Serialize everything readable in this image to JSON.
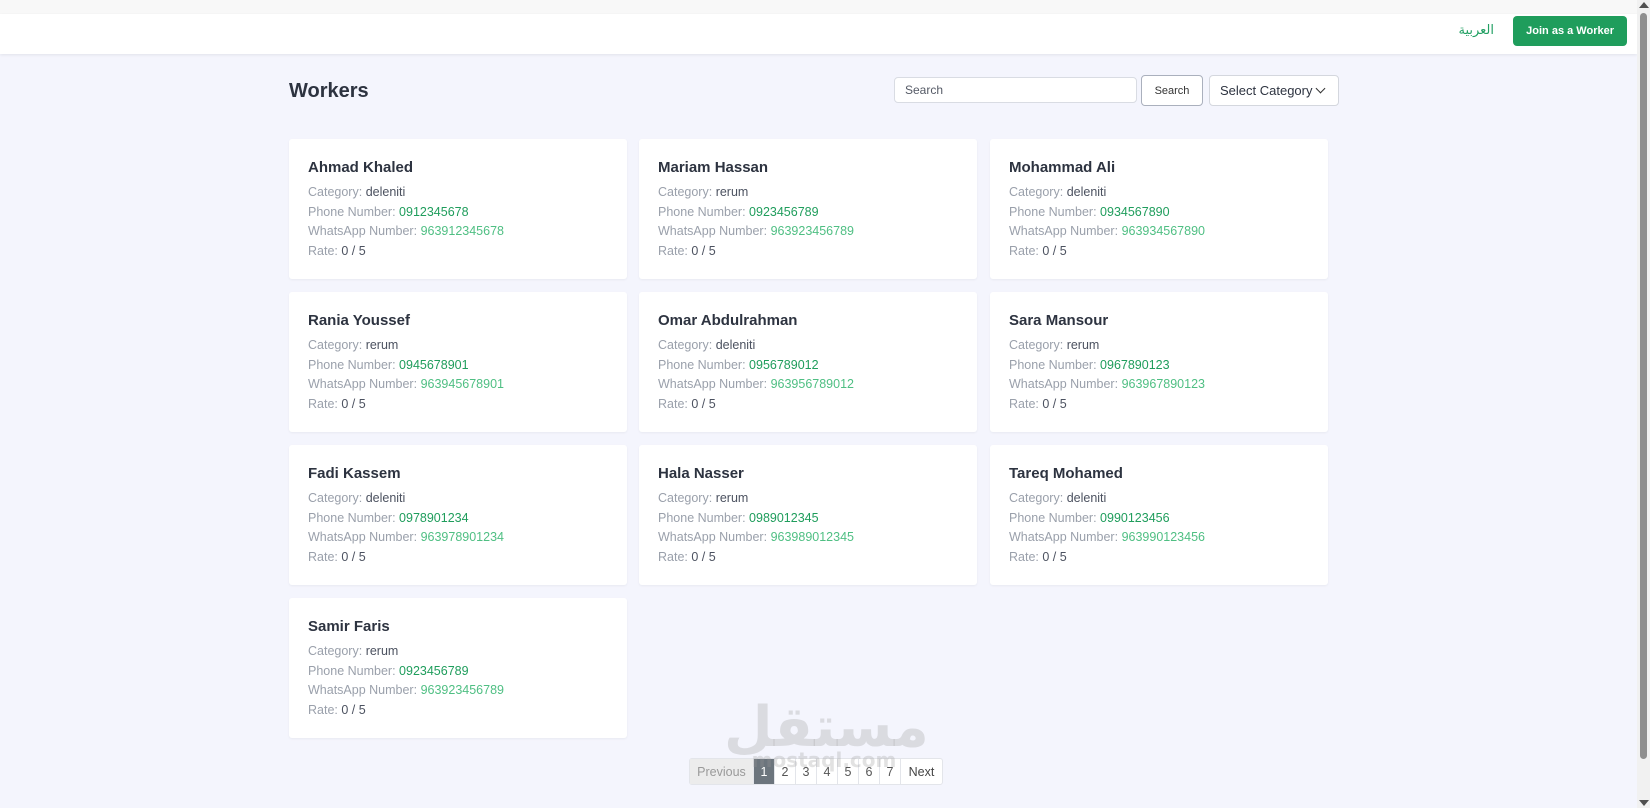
{
  "header": {
    "language_link": "العربية",
    "join_button": "Join as a Worker"
  },
  "page": {
    "title": "Workers"
  },
  "search": {
    "placeholder": "Search",
    "button_label": "Search",
    "category_select": "Select Category"
  },
  "labels": {
    "category": "Category:",
    "phone": "Phone Number:",
    "whatsapp": "WhatsApp Number:",
    "rate": "Rate:"
  },
  "workers": [
    {
      "name": "Ahmad Khaled",
      "category": "deleniti",
      "phone": "0912345678",
      "whatsapp": "963912345678",
      "rate": "0 / 5"
    },
    {
      "name": "Mariam Hassan",
      "category": "rerum",
      "phone": "0923456789",
      "whatsapp": "963923456789",
      "rate": "0 / 5"
    },
    {
      "name": "Mohammad Ali",
      "category": "deleniti",
      "phone": "0934567890",
      "whatsapp": "963934567890",
      "rate": "0 / 5"
    },
    {
      "name": "Rania Youssef",
      "category": "rerum",
      "phone": "0945678901",
      "whatsapp": "963945678901",
      "rate": "0 / 5"
    },
    {
      "name": "Omar Abdulrahman",
      "category": "deleniti",
      "phone": "0956789012",
      "whatsapp": "963956789012",
      "rate": "0 / 5"
    },
    {
      "name": "Sara Mansour",
      "category": "rerum",
      "phone": "0967890123",
      "whatsapp": "963967890123",
      "rate": "0 / 5"
    },
    {
      "name": "Fadi Kassem",
      "category": "deleniti",
      "phone": "0978901234",
      "whatsapp": "963978901234",
      "rate": "0 / 5"
    },
    {
      "name": "Hala Nasser",
      "category": "rerum",
      "phone": "0989012345",
      "whatsapp": "963989012345",
      "rate": "0 / 5"
    },
    {
      "name": "Tareq Mohamed",
      "category": "deleniti",
      "phone": "0990123456",
      "whatsapp": "963990123456",
      "rate": "0 / 5"
    },
    {
      "name": "Samir Faris",
      "category": "rerum",
      "phone": "0923456789",
      "whatsapp": "963923456789",
      "rate": "0 / 5"
    }
  ],
  "pagination": {
    "previous": "Previous",
    "next": "Next",
    "pages": [
      "1",
      "2",
      "3",
      "4",
      "5",
      "6",
      "7"
    ],
    "active": "1"
  },
  "watermark": {
    "arabic": "مستقل",
    "latin": "mostaql.com"
  },
  "colors": {
    "accent": "#1f9d5c",
    "background": "#f4f5fd",
    "active_page": "#6c757d"
  }
}
